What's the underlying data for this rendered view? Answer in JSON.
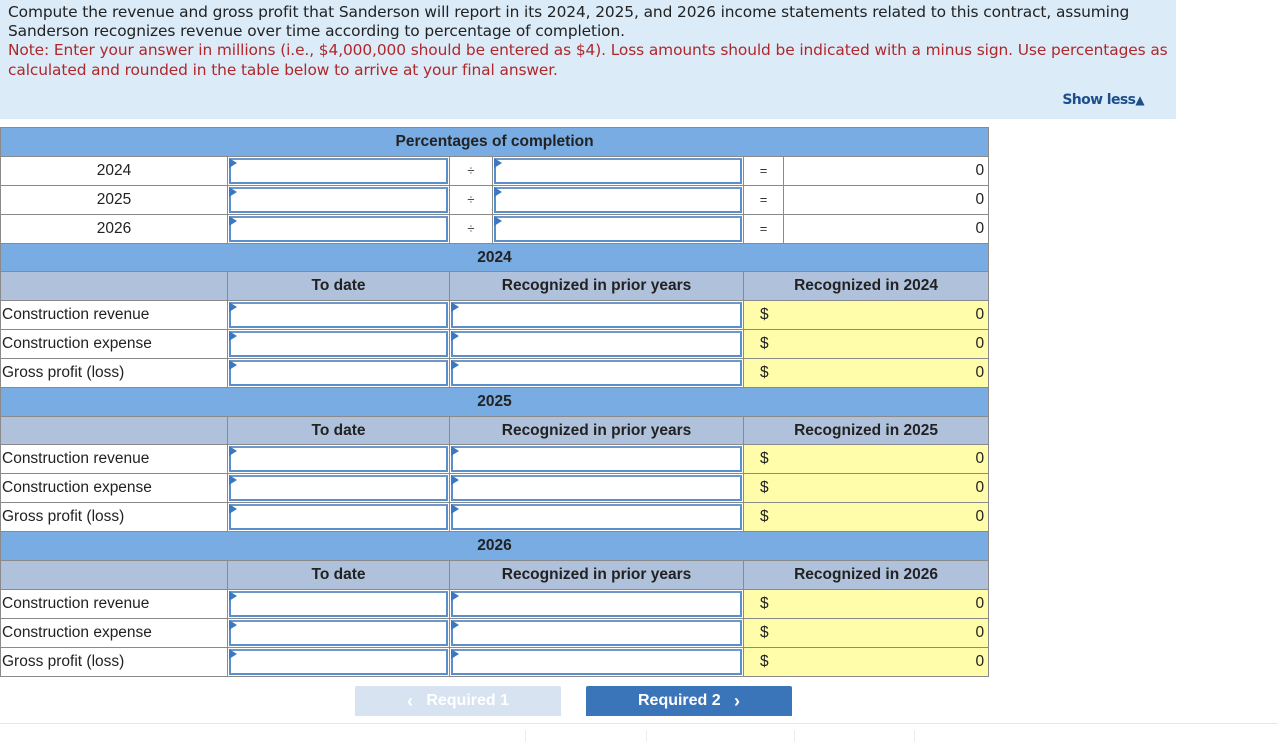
{
  "instructions": {
    "question": "Compute the revenue and gross profit that Sanderson will report in its 2024, 2025, and 2026 income statements related to this contract, assuming Sanderson recognizes revenue over time according to percentage of completion.",
    "note": "Note: Enter your answer in millions (i.e., $4,000,000 should be entered as $4). Loss amounts should be indicated with a minus sign. Use percentages as calculated and rounded in the table below to arrive at your final answer.",
    "toggle_label": "Show less",
    "toggle_icon": "triangle-up-icon"
  },
  "percentages": {
    "title": "Percentages of completion",
    "divide_symbol": "÷",
    "equals_symbol": "=",
    "rows": [
      {
        "year": "2024",
        "numerator": "",
        "denominator": "",
        "result": "0"
      },
      {
        "year": "2025",
        "numerator": "",
        "denominator": "",
        "result": "0"
      },
      {
        "year": "2026",
        "numerator": "",
        "denominator": "",
        "result": "0"
      }
    ]
  },
  "sections": [
    {
      "year": "2024",
      "col_to_date": "To date",
      "col_prior": "Recognized in prior years",
      "col_current": "Recognized in 2024",
      "rows": [
        {
          "label": "Construction revenue",
          "to_date": "",
          "prior": "",
          "currency": "$",
          "current": "0"
        },
        {
          "label": "Construction expense",
          "to_date": "",
          "prior": "",
          "currency": "$",
          "current": "0"
        },
        {
          "label": "Gross profit (loss)",
          "to_date": "",
          "prior": "",
          "currency": "$",
          "current": "0"
        }
      ]
    },
    {
      "year": "2025",
      "col_to_date": "To date",
      "col_prior": "Recognized in prior years",
      "col_current": "Recognized in 2025",
      "rows": [
        {
          "label": "Construction revenue",
          "to_date": "",
          "prior": "",
          "currency": "$",
          "current": "0"
        },
        {
          "label": "Construction expense",
          "to_date": "",
          "prior": "",
          "currency": "$",
          "current": "0"
        },
        {
          "label": "Gross profit (loss)",
          "to_date": "",
          "prior": "",
          "currency": "$",
          "current": "0"
        }
      ]
    },
    {
      "year": "2026",
      "col_to_date": "To date",
      "col_prior": "Recognized in prior years",
      "col_current": "Recognized in 2026",
      "rows": [
        {
          "label": "Construction revenue",
          "to_date": "",
          "prior": "",
          "currency": "$",
          "current": "0"
        },
        {
          "label": "Construction expense",
          "to_date": "",
          "prior": "",
          "currency": "$",
          "current": "0"
        },
        {
          "label": "Gross profit (loss)",
          "to_date": "",
          "prior": "",
          "currency": "$",
          "current": "0"
        }
      ]
    }
  ],
  "navigation": {
    "prev_label": "Required 1",
    "prev_icon": "chevron-left-icon",
    "next_label": "Required 2",
    "next_icon": "chevron-right-icon"
  },
  "colors": {
    "instruction_bg": "#dbebf8",
    "note_text": "#b0272a",
    "section_header": "#78ace3",
    "column_header": "#b0c1dc",
    "computed_cell": "#fffdaa",
    "input_border": "#5b8fcc",
    "next_button": "#3a74b9",
    "prev_button_disabled": "#d8e3f1"
  }
}
